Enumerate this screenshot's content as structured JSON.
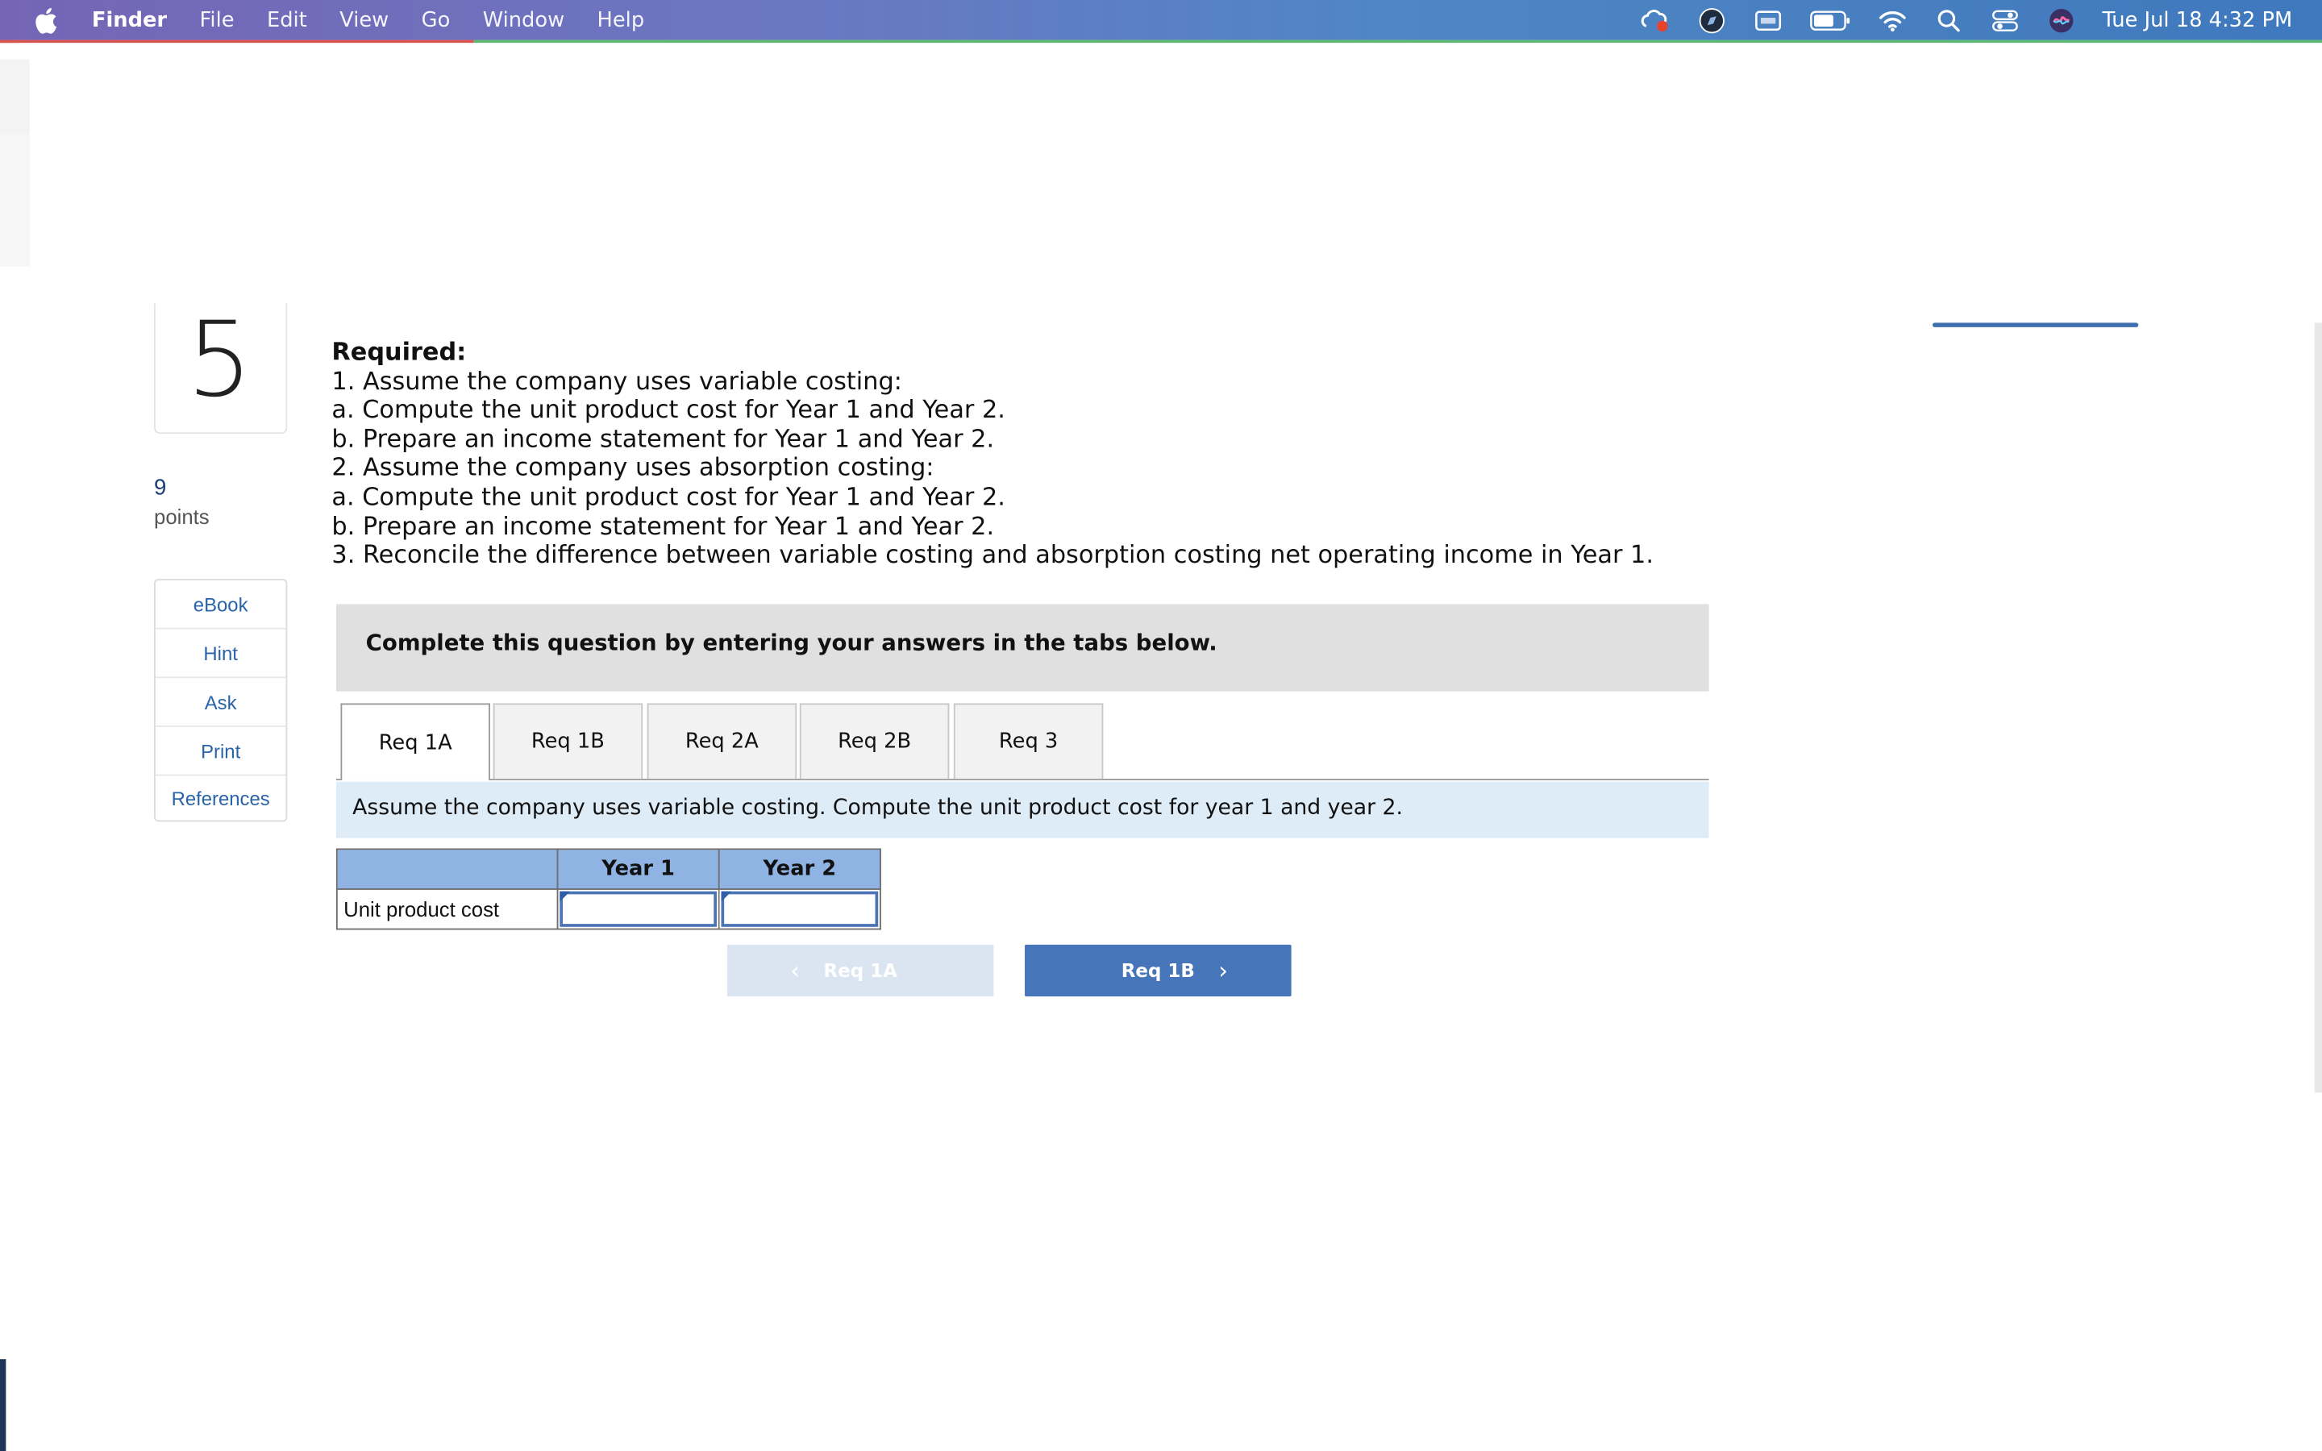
{
  "menubar": {
    "app_name": "Finder",
    "items": [
      "File",
      "Edit",
      "View",
      "Go",
      "Window",
      "Help"
    ],
    "clock": "Tue Jul 18  4:32 PM"
  },
  "question": {
    "number": "5",
    "points_value": "9",
    "points_label": "points"
  },
  "side_menu": [
    "eBook",
    "Hint",
    "Ask",
    "Print",
    "References"
  ],
  "required": {
    "title": "Required:",
    "lines": [
      "1. Assume the company uses variable costing:",
      "a. Compute the unit product cost for Year 1 and Year 2.",
      "b. Prepare an income statement for Year 1 and Year 2.",
      "2. Assume the company uses absorption costing:",
      "a. Compute the unit product cost for Year 1 and Year 2.",
      "b. Prepare an income statement for Year 1 and Year 2.",
      "3. Reconcile the difference between variable costing and absorption costing net operating income in Year 1."
    ]
  },
  "banner": "Complete this question by entering your answers in the tabs below.",
  "tabs": [
    "Req 1A",
    "Req 1B",
    "Req 2A",
    "Req 2B",
    "Req 3"
  ],
  "active_tab": "Req 1A",
  "subbanner": "Assume the company uses variable costing. Compute the unit product cost for year 1 and year 2.",
  "table": {
    "headers": [
      "",
      "Year 1",
      "Year 2"
    ],
    "row_label": "Unit product cost",
    "year1_value": "",
    "year2_value": ""
  },
  "nav": {
    "prev_label": "Req 1A",
    "next_label": "Req 1B"
  },
  "colors": {
    "accent_blue": "#4676b9",
    "header_blue": "#8fb4e3",
    "subbanner_bg": "#deecf8",
    "banner_bg": "#e0e0e0"
  }
}
